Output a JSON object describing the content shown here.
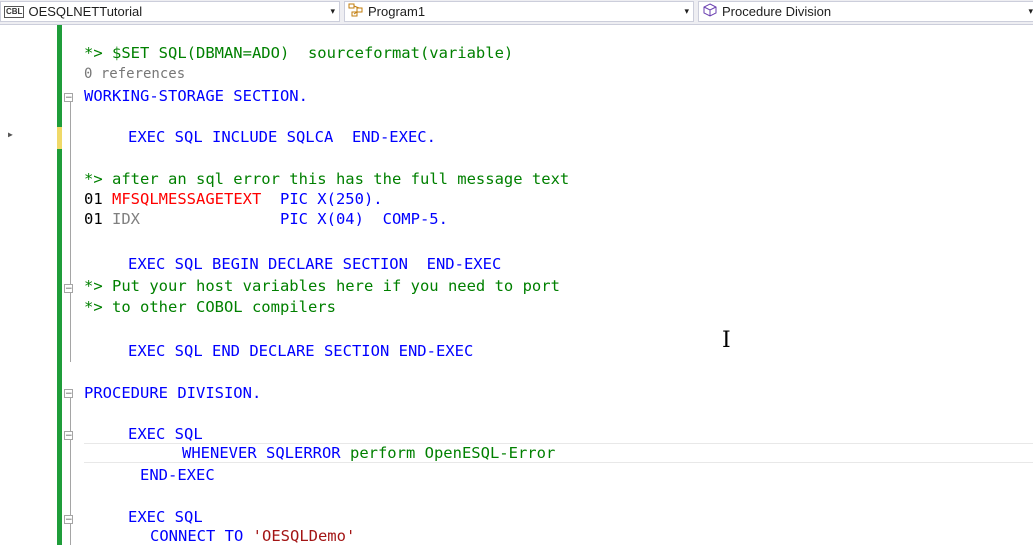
{
  "navbar": {
    "project": {
      "icon": "cobol-project-icon",
      "icon_text": "CBL",
      "label": "OESQLNETTutorial"
    },
    "class": {
      "icon": "class-icon",
      "label": "Program1"
    },
    "member": {
      "icon": "cube-icon",
      "label": "Procedure Division"
    },
    "dropdown_glyph": "▾"
  },
  "editor": {
    "lines": {
      "l1_directive": "*> $SET SQL(DBMAN=ADO)  sourceformat(variable)",
      "l2_refs": "0 references",
      "l3_ws": "WORKING-STORAGE SECTION.",
      "l4_include": "EXEC SQL INCLUDE SQLCA  END-EXEC.",
      "l5_comment": "*> after an sql error this has the full message text",
      "l6_num": "01 ",
      "l6_name": "MFSQLMESSAGETEXT",
      "l6_pad": "  ",
      "l6_pic": "PIC X(250).",
      "l7_num": "01 ",
      "l7_name": "IDX",
      "l7_pad": "               ",
      "l7_pic": "PIC X(04)  COMP-5.",
      "l8_begin": "EXEC SQL BEGIN DECLARE SECTION  END-EXEC",
      "l9_comment": "*> Put your host variables here if you need to port",
      "l10_comment": "*> to other COBOL compilers",
      "l11_end": "EXEC SQL END DECLARE SECTION END-EXEC",
      "l12_proc": "PROCEDURE DIVISION.",
      "l13_exec": "EXEC SQL",
      "l14_whenever": "WHENEVER SQLERROR ",
      "l14_perform": "perform OpenESQL-Error",
      "l15_endexec": "END-EXEC",
      "l16_exec": "EXEC SQL",
      "l17_connect": "CONNECT TO ",
      "l17_str": "'OESQLDemo'"
    },
    "fold_glyph": "−",
    "breakpoint_glyph": "▶",
    "cursor_glyph": "I"
  },
  "colors": {
    "keyword": "#0000ff",
    "comment": "#008000",
    "error_var": "#ff0000",
    "string": "#a31515",
    "change_saved": "#1f9d3a",
    "change_unsaved": "#f0d968"
  }
}
